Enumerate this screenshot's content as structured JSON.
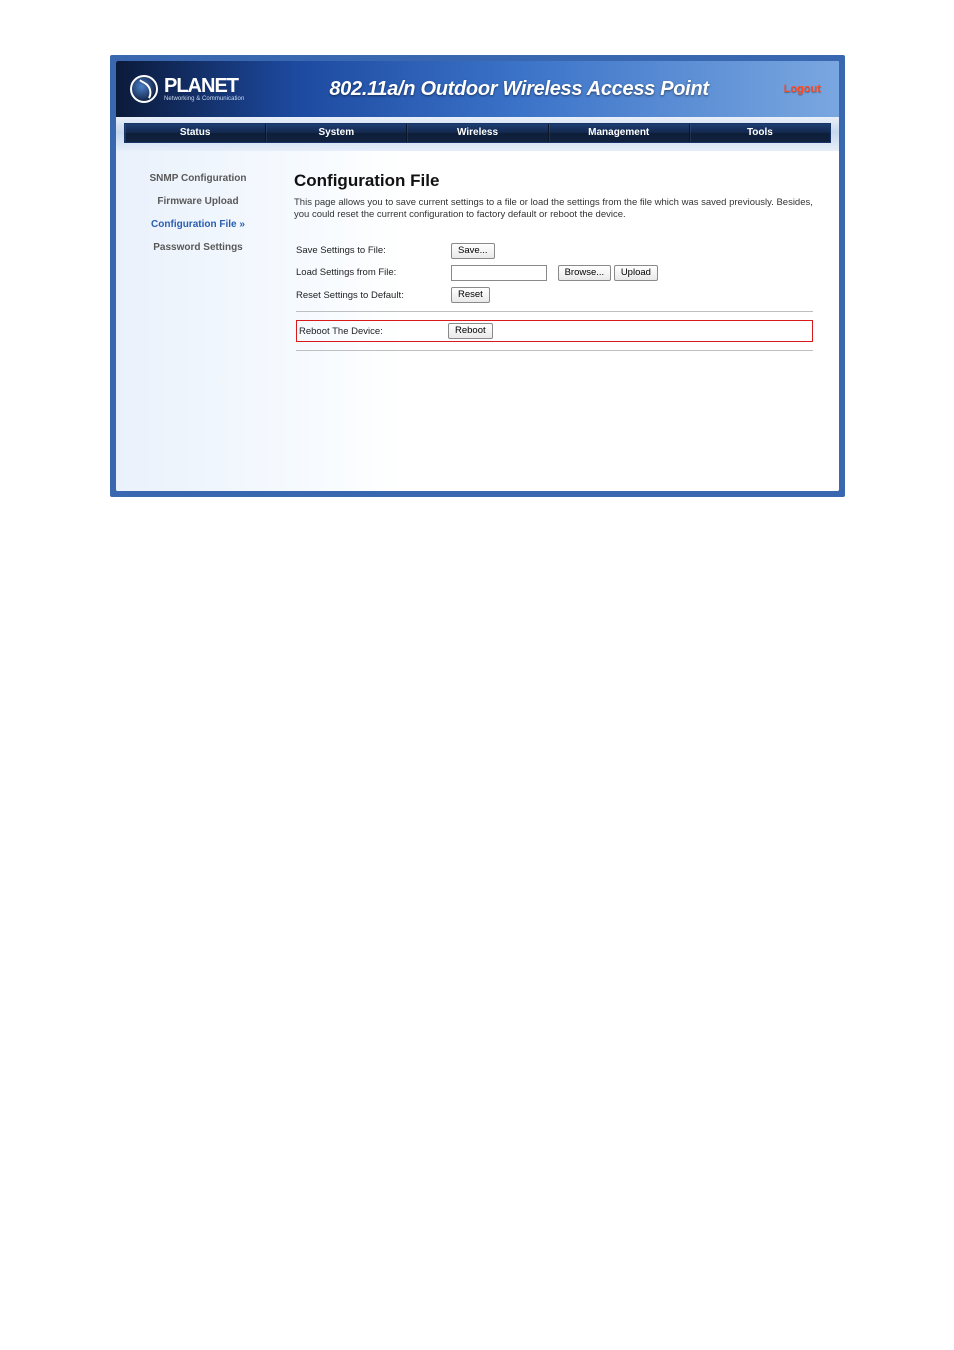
{
  "brand": {
    "name": "PLANET",
    "tagline": "Networking & Communication"
  },
  "header": {
    "title": "802.11a/n Outdoor Wireless Access Point",
    "logout": "Logout"
  },
  "topnav": {
    "items": [
      {
        "label": "Status",
        "active": false
      },
      {
        "label": "System",
        "active": false
      },
      {
        "label": "Wireless",
        "active": false
      },
      {
        "label": "Management",
        "active": true
      },
      {
        "label": "Tools",
        "active": false
      }
    ]
  },
  "sidebar": {
    "items": [
      {
        "label": "SNMP Configuration",
        "active": false
      },
      {
        "label": "Firmware Upload",
        "active": false
      },
      {
        "label": "Configuration File",
        "active": true
      },
      {
        "label": "Password Settings",
        "active": false
      }
    ]
  },
  "content": {
    "title": "Configuration File",
    "description": "This page allows you to save current settings to a file or load the settings from the file which was saved previously. Besides, you could reset the current configuration to factory default or reboot the device.",
    "rows": {
      "save": {
        "label": "Save Settings to File:",
        "button": "Save..."
      },
      "load": {
        "label": "Load Settings from File:",
        "file_value": "",
        "browse": "Browse...",
        "upload": "Upload"
      },
      "reset": {
        "label": "Reset Settings to Default:",
        "button": "Reset"
      },
      "reboot": {
        "label": "Reboot The Device:",
        "button": "Reboot"
      }
    }
  }
}
